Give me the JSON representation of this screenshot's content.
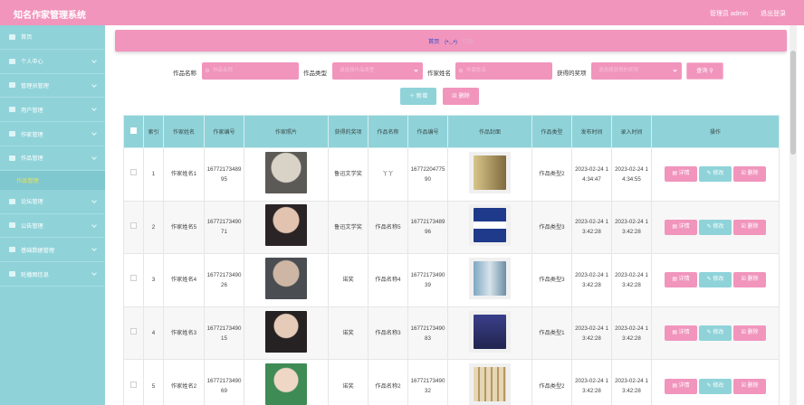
{
  "app": {
    "title": "知名作家管理系统",
    "user": "管理员 admin",
    "logout": "退出登录"
  },
  "sidebar": {
    "items": [
      {
        "label": "首页",
        "icon": "home-icon",
        "chevron": false
      },
      {
        "label": "个人中心",
        "icon": "user-icon",
        "chevron": true
      },
      {
        "label": "管理员管理",
        "icon": "admin-icon",
        "chevron": true
      },
      {
        "label": "用户管理",
        "icon": "users-icon",
        "chevron": true
      },
      {
        "label": "作家管理",
        "icon": "writer-icon",
        "chevron": true
      },
      {
        "label": "作品管理",
        "icon": "book-icon",
        "chevron": true
      },
      {
        "label": "作品管理",
        "icon": "",
        "sub": true
      },
      {
        "label": "论坛管理",
        "icon": "forum-icon",
        "chevron": true
      },
      {
        "label": "公告管理",
        "icon": "notice-icon",
        "chevron": true
      },
      {
        "label": "基础数据管理",
        "icon": "data-icon",
        "chevron": true
      },
      {
        "label": "轮播图信息",
        "icon": "image-icon",
        "chevron": true
      }
    ]
  },
  "breadcrumb": {
    "home": "首页",
    "emoji": "(•◡•)",
    "current": "作品"
  },
  "search": {
    "labels": [
      "作品名称",
      "作品类型",
      "作家姓名",
      "获得的奖项"
    ],
    "placeholders": [
      "作品名称",
      "请选择作品类型",
      "作家姓名",
      "请选择获得的奖项"
    ],
    "button": "查询"
  },
  "actions": {
    "add": "新增",
    "delete": "删除"
  },
  "table": {
    "headers": [
      "",
      "索引",
      "作家姓名",
      "作家编号",
      "作家照片",
      "获得的奖项",
      "作品名称",
      "作品编号",
      "作品封面",
      "作品类型",
      "发布时间",
      "录入时间",
      "操作"
    ],
    "rows": [
      {
        "idx": "1",
        "name": "作家姓名1",
        "wid": "1677217348995",
        "award": "鲁迅文学奖",
        "work": "丫丫",
        "bid": "1677220477590",
        "type": "作品类型2",
        "pub": "2023-02-24 14:34:47",
        "rec": "2023-02-24 14:34:55"
      },
      {
        "idx": "2",
        "name": "作家姓名5",
        "wid": "1677217349071",
        "award": "鲁迅文学奖",
        "work": "作品名称5",
        "bid": "1677217348996",
        "type": "作品类型3",
        "pub": "2023-02-24 13:42:28",
        "rec": "2023-02-24 13:42:28"
      },
      {
        "idx": "3",
        "name": "作家姓名4",
        "wid": "1677217349026",
        "award": "诺奖",
        "work": "作品名称4",
        "bid": "1677217349039",
        "type": "作品类型3",
        "pub": "2023-02-24 13:42:28",
        "rec": "2023-02-24 13:42:28"
      },
      {
        "idx": "4",
        "name": "作家姓名3",
        "wid": "1677217349015",
        "award": "诺奖",
        "work": "作品名称3",
        "bid": "1677217349083",
        "type": "作品类型1",
        "pub": "2023-02-24 13:42:28",
        "rec": "2023-02-24 13:42:28"
      },
      {
        "idx": "5",
        "name": "作家姓名2",
        "wid": "1677217349069",
        "award": "诺奖",
        "work": "作品名称2",
        "bid": "1677217349032",
        "type": "作品类型2",
        "pub": "2023-02-24 13:42:28",
        "rec": "2023-02-24 13:42:28"
      }
    ],
    "ops": {
      "detail": "详情",
      "edit": "修改",
      "remove": "删除"
    }
  },
  "colors": {
    "pink": "#f195bd",
    "teal": "#8fd3d9",
    "breadcrumb_link": "#3a4cc4"
  }
}
